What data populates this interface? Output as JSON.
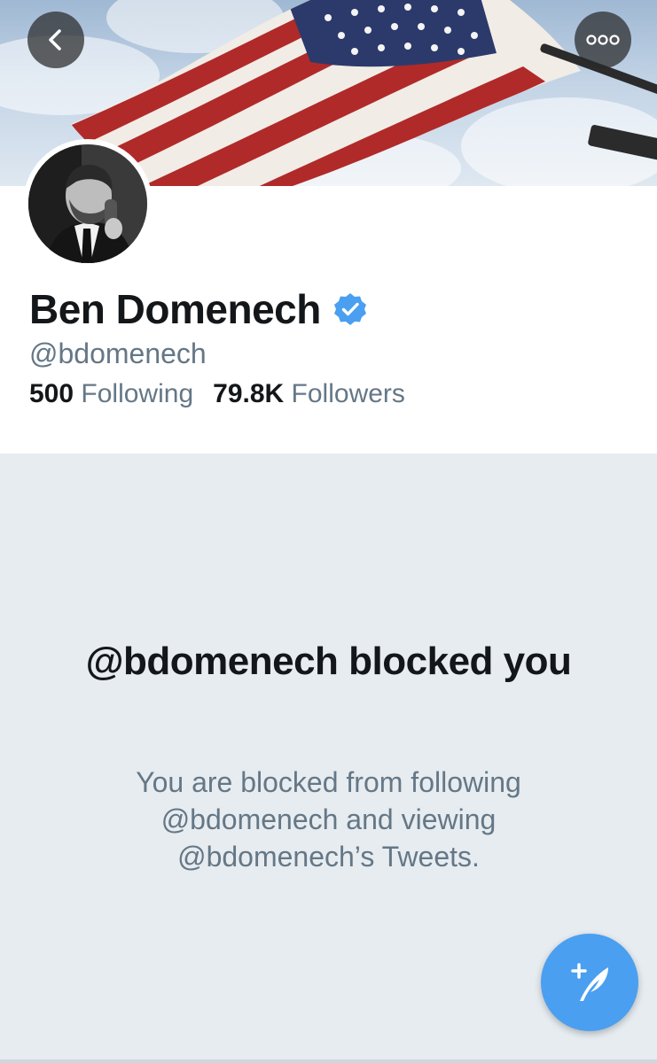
{
  "header": {
    "back_icon": "chevron-left-icon",
    "more_icon": "more-dots-icon",
    "banner": "american-flag-banner"
  },
  "profile": {
    "display_name": "Ben Domenech",
    "verified_icon": "verified-badge-icon",
    "verified_color": "#4a9ff0",
    "handle": "@bdomenech",
    "following_count": "500",
    "following_label": "Following",
    "followers_count": "79.8K",
    "followers_label": "Followers"
  },
  "blocked": {
    "title": "@bdomenech blocked you",
    "description": "You are blocked from following @bdomenech and viewing @bdomenech’s Tweets."
  },
  "compose": {
    "icon": "compose-tweet-icon",
    "color": "#4a9ff0"
  }
}
